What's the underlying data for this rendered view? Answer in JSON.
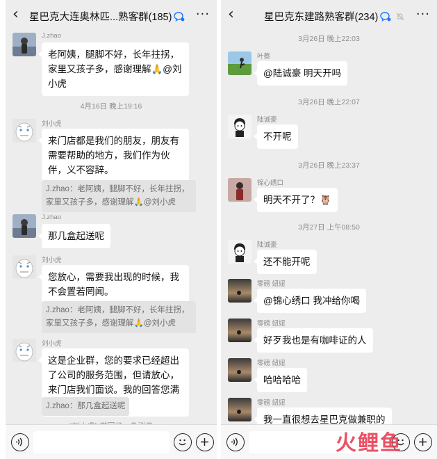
{
  "left": {
    "title": "星巴克大连奥林匹...熟客群(185)",
    "more": "···",
    "messages": [
      {
        "sender": "J.zhao",
        "text": "老阿姨，腿脚不好，长年拄拐，家里又孩子多，感谢理解🙏@刘小虎"
      },
      {
        "time": "4月16日 晚上19:16"
      },
      {
        "sender": "刘小虎",
        "text": "来门店都是我们的朋友，朋友有需要帮助的地方，我们作为伙伴，义不容辞。",
        "quote": "J.zhao：老阿姨，腿脚不好，长年拄拐，家里又孩子多，感谢理解🙏@刘小虎"
      },
      {
        "sender": "J.zhao",
        "text": "那几盒起送呢"
      },
      {
        "sender": "刘小虎",
        "text": "您放心，需要我出现的时候，我不会置若罔闻。",
        "quote": "J.zhao：老阿姨，腿脚不好，长年拄拐，家里又孩子多，感谢理解🙏@刘小虎"
      },
      {
        "sender": "刘小虎",
        "text": "这是企业群，您的要求已经超出了公司的服务范围，但请放心，来门店我们面谈。我的回答您满意吗?",
        "quote": "J.zhao：那几盒起送呢"
      }
    ],
    "recall": "\"刘小虎\" 撤回了一条消息"
  },
  "right": {
    "title": "星巴克东建路熟客群(234)",
    "more": "···",
    "messages": [
      {
        "time": "3月26日 晚上22:03"
      },
      {
        "sender": "叶蔡",
        "text": "@陆诚豪  明天开吗"
      },
      {
        "time": "3月26日 晚上22:07"
      },
      {
        "sender": "陆诚豪",
        "text": "不开呢"
      },
      {
        "time": "3月26日 晚上23:37"
      },
      {
        "sender": "锦心绣口",
        "text": "明天不开了？🦉"
      },
      {
        "time": "3月27日 上午08:50"
      },
      {
        "sender": "陆诚豪",
        "text": "还不能开呢"
      },
      {
        "sender": "零磅 妞妞",
        "text": "@锦心绣口  我冲给你喝"
      },
      {
        "sender": "零磅 妞妞",
        "text": "好歹我也是有咖啡证的人"
      },
      {
        "sender": "零磅 妞妞",
        "text": "哈哈哈哈"
      },
      {
        "sender": "零磅 妞妞",
        "text": "我一直很想去星巴克做兼职的"
      }
    ]
  },
  "watermark": "火鲤鱼",
  "icons": [
    "back-icon",
    "group-chat-icon",
    "mute-bell-icon",
    "more-icon",
    "voice-icon",
    "emoji-icon",
    "plus-icon"
  ]
}
